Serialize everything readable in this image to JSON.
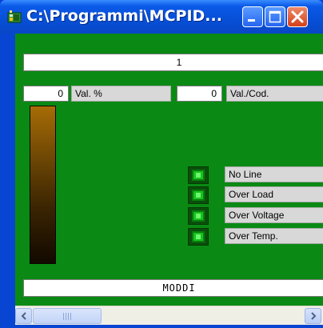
{
  "window": {
    "title": "C:\\Programmi\\MCPID..."
  },
  "panel": {
    "title_value": "1",
    "val_percent_value": "0",
    "val_percent_label": "Val. %",
    "val_code_value": "0",
    "val_code_label": "Val./Cod.",
    "level_fraction": 1.0,
    "status_items": [
      {
        "label": "No Line"
      },
      {
        "label": "Over Load"
      },
      {
        "label": "Over Voltage"
      },
      {
        "label": "Over Temp."
      }
    ],
    "footer_value": "MODDI"
  },
  "colors": {
    "client_background": "#0a8a14",
    "led_on": "#17c41c",
    "bar_top": "#a66c06",
    "bar_bottom": "#120900"
  },
  "icons": {
    "app": "app-icon",
    "minimize": "minimize-icon",
    "maximize": "maximize-icon",
    "close": "close-icon",
    "scroll_left": "arrow-left-icon",
    "scroll_right": "arrow-right-icon"
  }
}
